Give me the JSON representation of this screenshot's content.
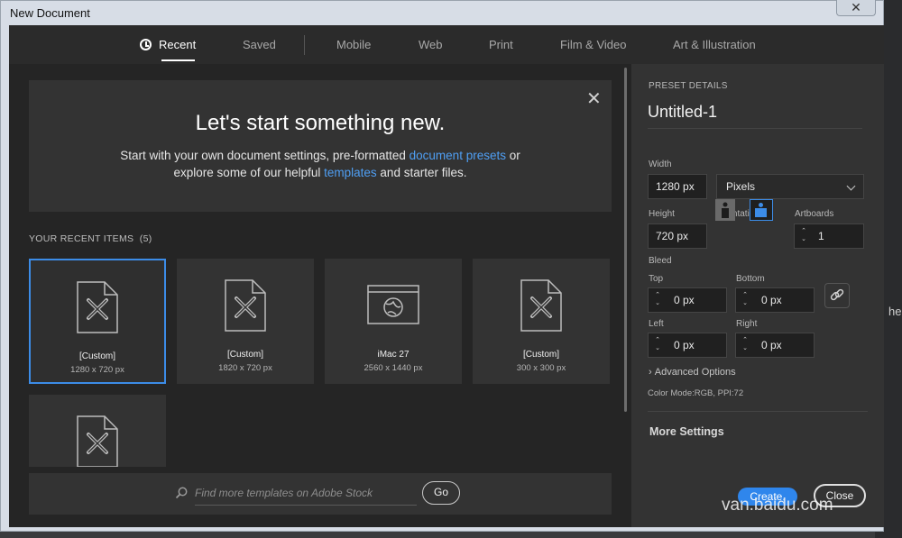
{
  "window": {
    "title": "New Document",
    "close_glyph": "✕"
  },
  "tabs": [
    {
      "label": "Recent",
      "active": true
    },
    {
      "label": "Saved"
    },
    {
      "label": "Mobile"
    },
    {
      "label": "Web"
    },
    {
      "label": "Print"
    },
    {
      "label": "Film & Video"
    },
    {
      "label": "Art & Illustration"
    }
  ],
  "hero": {
    "title": "Let's start something new.",
    "line1_pre": "Start with your own document settings, pre-formatted ",
    "line1_link": "document presets",
    "line1_post": " or",
    "line2_pre": "explore some of our helpful ",
    "line2_link": "templates",
    "line2_post": " and starter files.",
    "close_glyph": "✕"
  },
  "recent": {
    "heading": "YOUR RECENT ITEMS",
    "count": "(5)",
    "items": [
      {
        "name": "[Custom]",
        "dims": "1280 x 720 px",
        "icon": "document-icon",
        "selected": true
      },
      {
        "name": "[Custom]",
        "dims": "1820 x 720 px",
        "icon": "document-icon"
      },
      {
        "name": "iMac 27",
        "dims": "2560 x 1440 px",
        "icon": "web-preset-icon"
      },
      {
        "name": "[Custom]",
        "dims": "300 x 300 px",
        "icon": "document-icon"
      },
      {
        "name": "",
        "dims": "",
        "icon": "document-icon"
      }
    ]
  },
  "search": {
    "placeholder": "Find more templates on Adobe Stock",
    "go_label": "Go"
  },
  "preset": {
    "heading": "PRESET DETAILS",
    "name": "Untitled-1",
    "width_label": "Width",
    "width_value": "1280 px",
    "units": "Pixels",
    "height_label": "Height",
    "height_value": "720 px",
    "orientation_label": "Orientation",
    "artboards_label": "Artboards",
    "artboards_value": "1",
    "bleed_label": "Bleed",
    "top_label": "Top",
    "top_value": "0 px",
    "bottom_label": "Bottom",
    "bottom_value": "0 px",
    "left_label": "Left",
    "left_value": "0 px",
    "right_label": "Right",
    "right_value": "0 px",
    "advanced_label": "Advanced Options",
    "color_mode": "Color Mode:RGB, PPI:72",
    "more_settings": "More Settings",
    "create_label": "Create.",
    "close_label": "Close"
  },
  "watermark": "van.baidu.com",
  "edge_text": "he",
  "colors": {
    "accent": "#3c8ce7",
    "link": "#4f9ff4",
    "panel": "#333333",
    "background": "#252525"
  }
}
